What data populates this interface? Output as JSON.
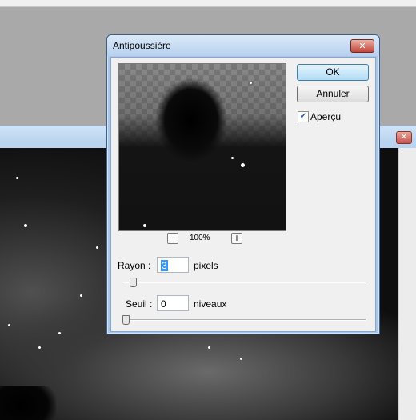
{
  "dialog": {
    "title": "Antipoussière",
    "close_glyph": "✕",
    "ok_label": "OK",
    "cancel_label": "Annuler",
    "preview_label": "Aperçu",
    "preview_checked": true,
    "zoom_minus": "−",
    "zoom_level": "100%",
    "zoom_plus": "+",
    "rayon_label": "Rayon :",
    "rayon_value": "3",
    "rayon_unit": "pixels",
    "rayon_slider_fraction": 0.03,
    "seuil_label": "Seuil :",
    "seuil_value": "0",
    "seuil_unit": "niveaux",
    "seuil_slider_fraction": 0.0
  },
  "background_window": {
    "close_glyph": "✕"
  }
}
